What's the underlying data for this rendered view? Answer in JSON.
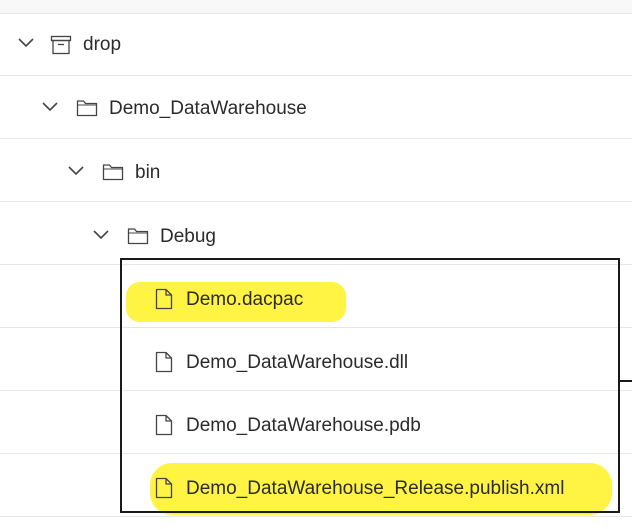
{
  "tree": {
    "items": [
      {
        "label": "drop",
        "type": "artifact",
        "expanded": true,
        "depth": 0
      },
      {
        "label": "Demo_DataWarehouse",
        "type": "folder",
        "expanded": true,
        "depth": 1
      },
      {
        "label": "bin",
        "type": "folder",
        "expanded": true,
        "depth": 2
      },
      {
        "label": "Debug",
        "type": "folder",
        "expanded": true,
        "depth": 3
      },
      {
        "label": "Demo.dacpac",
        "type": "file",
        "highlighted": true,
        "depth": 4
      },
      {
        "label": "Demo_DataWarehouse.dll",
        "type": "file",
        "highlighted": false,
        "depth": 4
      },
      {
        "label": "Demo_DataWarehouse.pdb",
        "type": "file",
        "highlighted": false,
        "depth": 4
      },
      {
        "label": "Demo_DataWarehouse_Release.publish.xml",
        "type": "file",
        "highlighted": true,
        "depth": 4
      }
    ]
  },
  "colors": {
    "highlight": "#fff23a",
    "text": "#2b2b2b",
    "divider": "#e6e6e6",
    "box": "#1a1a1a"
  },
  "icons": {
    "chevron": "chevron-down-icon",
    "artifact": "artifact-icon",
    "folder": "folder-icon",
    "file": "file-icon"
  }
}
